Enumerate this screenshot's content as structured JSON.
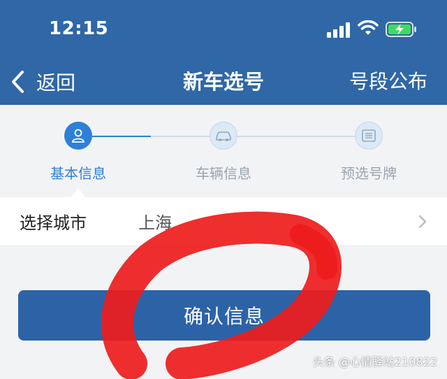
{
  "status_bar": {
    "time": "12:15"
  },
  "nav": {
    "back_label": "返回",
    "title": "新车选号",
    "right_label": "号段公布"
  },
  "steps": [
    {
      "label": "基本信息",
      "state": "active",
      "icon": "user-icon"
    },
    {
      "label": "车辆信息",
      "state": "inactive",
      "icon": "car-icon"
    },
    {
      "label": "预选号牌",
      "state": "inactive",
      "icon": "plate-icon"
    }
  ],
  "city": {
    "label": "选择城市",
    "value": "上海"
  },
  "confirm_label": "确认信息",
  "watermark": "头条 @心情驿站210822",
  "colors": {
    "brand": "#2f67a7",
    "accent": "#2f7fd6",
    "button": "#2c63a7",
    "marker": "#ee1c1c"
  }
}
